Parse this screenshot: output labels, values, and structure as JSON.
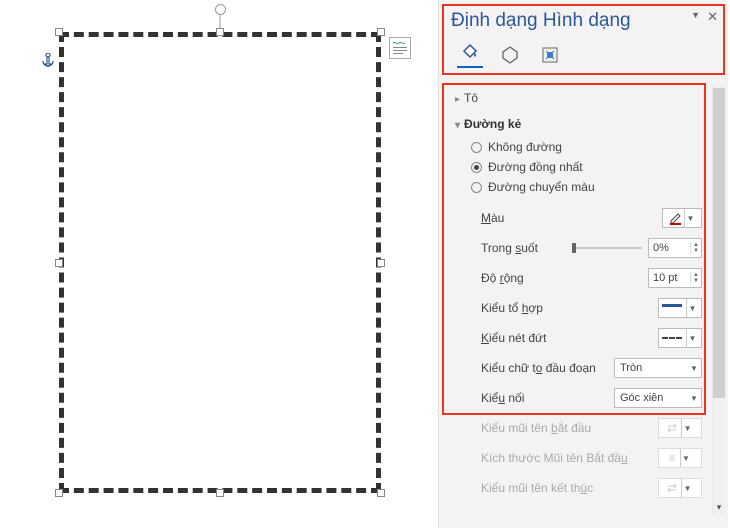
{
  "panel": {
    "title": "Định dạng Hình dạng",
    "sections": {
      "fill": "Tô",
      "line": "Đường kẻ"
    },
    "line_options": {
      "none": "Không đường",
      "solid": "Đường đồng nhất",
      "gradient": "Đường chuyển màu"
    },
    "props": {
      "color": "Màu",
      "transparency": "Trong suốt",
      "transparency_val": "0%",
      "width": "Độ rộng",
      "width_val": "10 pt",
      "compound": "Kiểu tổ hợp",
      "dash": "Kiểu nét đứt",
      "cap": "Kiểu chữ to đầu đoạn",
      "cap_val": "Tròn",
      "join": "Kiểu nối",
      "join_val": "Góc xiên",
      "arrow_begin_type": "Kiểu mũi tên bắt đầu",
      "arrow_begin_size": "Kích thước Mũi tên Bắt đầu",
      "arrow_end_type": "Kiểu mũi tên kết thúc"
    }
  }
}
